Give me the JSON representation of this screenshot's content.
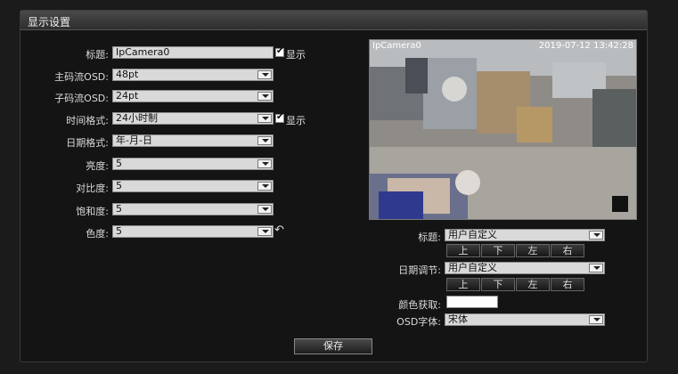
{
  "panel": {
    "title": "显示设置"
  },
  "form": {
    "title_label": "标题:",
    "title_value": "IpCamera0",
    "title_show": "显示",
    "main_osd_label": "主码流OSD:",
    "main_osd_value": "48pt",
    "sub_osd_label": "子码流OSD:",
    "sub_osd_value": "24pt",
    "time_format_label": "时间格式:",
    "time_format_value": "24小时制",
    "time_show": "显示",
    "date_format_label": "日期格式:",
    "date_format_value": "年-月-日",
    "brightness_label": "亮度:",
    "brightness_value": "5",
    "contrast_label": "对比度:",
    "contrast_value": "5",
    "saturation_label": "饱和度:",
    "saturation_value": "5",
    "hue_label": "色度:",
    "hue_value": "5"
  },
  "video": {
    "overlay_title": "IpCamera0",
    "overlay_time": "2019-07-12 13:42:28"
  },
  "osd": {
    "title_label": "标题:",
    "title_value": "用户自定义",
    "date_label": "日期调节:",
    "date_value": "用户自定义",
    "dir_up": "上",
    "dir_down": "下",
    "dir_left": "左",
    "dir_right": "右",
    "color_label": "颜色获取:",
    "font_label": "OSD字体:",
    "font_value": "宋体"
  },
  "actions": {
    "save": "保存"
  },
  "colors": {
    "panel_bg": "#141414",
    "header_bg": "#3c3c3c",
    "field_bg": "#d9d9d9"
  }
}
